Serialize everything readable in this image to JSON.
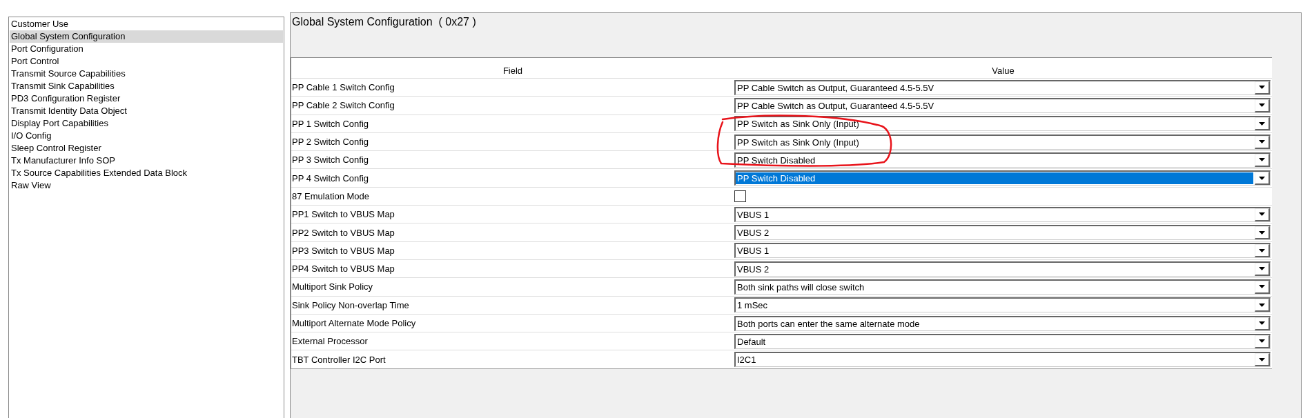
{
  "sidebar": {
    "items": [
      {
        "label": "Customer Use",
        "selected": false
      },
      {
        "label": "Global System Configuration",
        "selected": true
      },
      {
        "label": "Port Configuration",
        "selected": false
      },
      {
        "label": "Port Control",
        "selected": false
      },
      {
        "label": "Transmit Source Capabilities",
        "selected": false
      },
      {
        "label": "Transmit Sink Capabilities",
        "selected": false
      },
      {
        "label": "PD3 Configuration Register",
        "selected": false
      },
      {
        "label": "Transmit Identity Data Object",
        "selected": false
      },
      {
        "label": "Display Port Capabilities",
        "selected": false
      },
      {
        "label": "I/O Config",
        "selected": false
      },
      {
        "label": "Sleep Control Register",
        "selected": false
      },
      {
        "label": "Tx Manufacturer Info SOP",
        "selected": false
      },
      {
        "label": "Tx Source Capabilities Extended Data Block",
        "selected": false
      },
      {
        "label": "Raw View",
        "selected": false
      }
    ]
  },
  "panel": {
    "title": "Global System Configuration  ( 0x27 )"
  },
  "table": {
    "columns": [
      "Field",
      "Value"
    ],
    "rows": [
      {
        "kind": "dropdown",
        "field": "PP Cable 1 Switch Config",
        "value": "PP Cable Switch as Output, Guaranteed 4.5-5.5V",
        "focused": false
      },
      {
        "kind": "dropdown",
        "field": "PP Cable 2 Switch Config",
        "value": "PP Cable Switch as Output, Guaranteed 4.5-5.5V",
        "focused": false
      },
      {
        "kind": "dropdown",
        "field": "PP 1 Switch Config",
        "value": "PP Switch as Sink Only (Input)",
        "focused": false
      },
      {
        "kind": "dropdown",
        "field": "PP 2 Switch Config",
        "value": "PP Switch as Sink Only (Input)",
        "focused": false
      },
      {
        "kind": "dropdown",
        "field": "PP 3 Switch Config",
        "value": "PP Switch Disabled",
        "focused": false
      },
      {
        "kind": "dropdown",
        "field": "PP 4 Switch Config",
        "value": "PP Switch Disabled",
        "focused": true
      },
      {
        "kind": "checkbox",
        "field": "87 Emulation Mode",
        "checked": false
      },
      {
        "kind": "dropdown",
        "field": "PP1 Switch to VBUS Map",
        "value": "VBUS 1",
        "focused": false
      },
      {
        "kind": "dropdown",
        "field": "PP2 Switch to VBUS Map",
        "value": "VBUS 2",
        "focused": false
      },
      {
        "kind": "dropdown",
        "field": "PP3 Switch to VBUS Map",
        "value": "VBUS 1",
        "focused": false
      },
      {
        "kind": "dropdown",
        "field": "PP4 Switch to VBUS Map",
        "value": "VBUS 2",
        "focused": false
      },
      {
        "kind": "dropdown",
        "field": "Multiport Sink Policy",
        "value": "Both sink paths will close switch",
        "focused": false
      },
      {
        "kind": "dropdown",
        "field": "Sink Policy Non-overlap Time",
        "value": "1 mSec",
        "focused": false
      },
      {
        "kind": "dropdown",
        "field": "Multiport Alternate Mode Policy",
        "value": "Both ports can enter the same alternate mode",
        "focused": false
      },
      {
        "kind": "dropdown",
        "field": "External Processor",
        "value": "Default",
        "focused": false
      },
      {
        "kind": "dropdown",
        "field": "TBT Controller I2C Port",
        "value": "I2C1",
        "focused": false
      }
    ]
  }
}
